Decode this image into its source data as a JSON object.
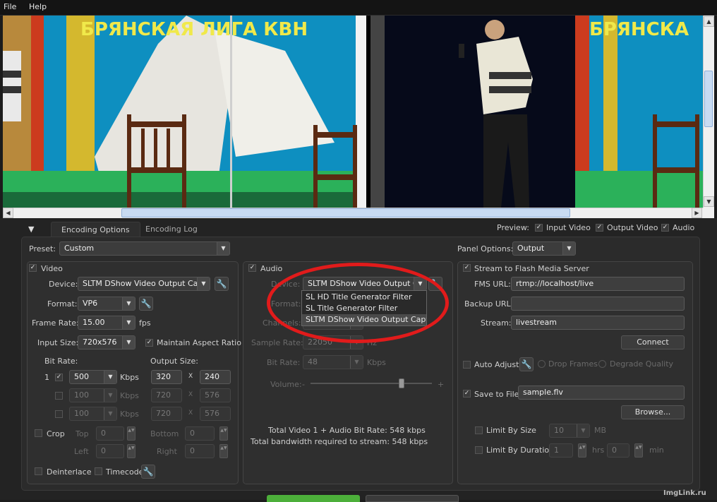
{
  "menu": {
    "file": "File",
    "help": "Help"
  },
  "tabs": {
    "encoding_options": "Encoding Options",
    "encoding_log": "Encoding Log"
  },
  "preview": {
    "label": "Preview:",
    "input_video": "Input Video",
    "output_video": "Output Video",
    "audio": "Audio"
  },
  "preset": {
    "label": "Preset:",
    "value": "Custom"
  },
  "panel_options": {
    "label": "Panel Options:",
    "value": "Output"
  },
  "video": {
    "title": "Video",
    "device_label": "Device:",
    "device_value": "SLTM DShow Video Output Captu",
    "format_label": "Format:",
    "format_value": "VP6",
    "frame_rate_label": "Frame Rate:",
    "frame_rate_value": "15.00",
    "fps": "fps",
    "input_size_label": "Input Size:",
    "input_size_value": "720x576",
    "maintain_aspect": "Maintain Aspect Ratio",
    "bit_rate_label": "Bit Rate:",
    "output_size_label": "Output Size:",
    "rows": [
      {
        "num": "1",
        "rate": "500",
        "unit": "Kbps",
        "w": "320",
        "x": "X",
        "h": "240"
      },
      {
        "num": "",
        "rate": "100",
        "unit": "Kbps",
        "w": "720",
        "x": "X",
        "h": "576"
      },
      {
        "num": "",
        "rate": "100",
        "unit": "Kbps",
        "w": "720",
        "x": "X",
        "h": "576"
      }
    ],
    "crop": "Crop",
    "top": "Top",
    "top_value": "0",
    "bottom": "Bottom",
    "bottom_value": "0",
    "left": "Left",
    "left_value": "0",
    "right": "Right",
    "right_value": "0",
    "deinterlace": "Deinterlace",
    "timecode": "Timecode"
  },
  "audio": {
    "title": "Audio",
    "device_label": "Device:",
    "device_value": "SLTM DShow Video Output Cap",
    "format_label": "Format:",
    "channels_label": "Channels:",
    "sample_rate_label": "Sample Rate:",
    "sample_rate_value": "22050",
    "hz": "Hz",
    "bit_rate_label": "Bit Rate:",
    "bit_rate_value": "48",
    "kbps": "Kbps",
    "volume_label": "Volume:",
    "minus": "-",
    "plus": "+",
    "dropdown_options": [
      "SL HD Title Generator Filter",
      "SL Title Generator Filter",
      "SLTM DShow Video Output Capture"
    ],
    "total_bitrate": "Total Video 1 + Audio Bit Rate:  548 kbps",
    "total_bandwidth": "Total bandwidth required to stream:  548 kbps"
  },
  "stream": {
    "title": "Stream to Flash Media Server",
    "fms_url_label": "FMS URL:",
    "fms_url_value": "rtmp://localhost/live",
    "backup_url_label": "Backup URL:",
    "backup_url_value": "",
    "stream_label": "Stream:",
    "stream_value": "livestream",
    "connect": "Connect",
    "auto_adjust": "Auto Adjust",
    "drop_frames": "Drop Frames",
    "degrade_quality": "Degrade Quality",
    "save_to_file": "Save to File",
    "file_value": "sample.flv",
    "browse": "Browse...",
    "limit_size": "Limit By Size",
    "limit_size_value": "10",
    "mb": "MB",
    "limit_duration": "Limit By Duration",
    "hrs_value": "1",
    "hrs": "hrs",
    "min_value": "0",
    "min": "min"
  },
  "video_preview_text": {
    "left_banner": "БРЯНСКАЯ ЛИГА КВН",
    "right_banner": "БРЯНСКА"
  },
  "watermark": "ImgLink.ru",
  "colors": {
    "highlight_oval": "#e11b1b",
    "start_button": "#4caf3a"
  }
}
